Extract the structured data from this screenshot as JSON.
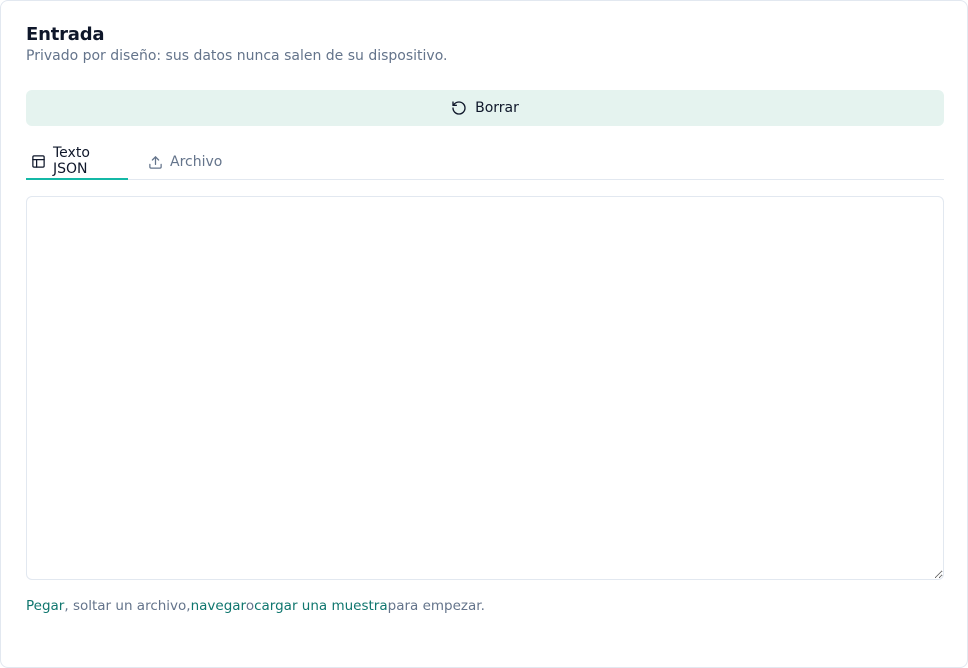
{
  "section": {
    "title": "Entrada",
    "subtitle": "Privado por diseño: sus datos nunca salen de su dispositivo."
  },
  "clear_button": {
    "label": "Borrar",
    "icon": "rotate-ccw-icon"
  },
  "tabs": [
    {
      "label": "Texto JSON",
      "icon": "table-icon",
      "active": true
    },
    {
      "label": "Archivo",
      "icon": "upload-icon",
      "active": false
    }
  ],
  "editor": {
    "value": "",
    "placeholder": ""
  },
  "hint": {
    "paste_link": "Pegar",
    "text_after_paste": ", soltar un archivo,",
    "browse_link": "navegar",
    "text_or": "o",
    "sample_link": "cargar una muestra",
    "text_end": "para empezar."
  },
  "colors": {
    "accent": "#14b8a6",
    "link": "#0f766e",
    "button_bg": "#e5f3ef",
    "muted_text": "#64748b",
    "border": "#e2e8f0"
  }
}
